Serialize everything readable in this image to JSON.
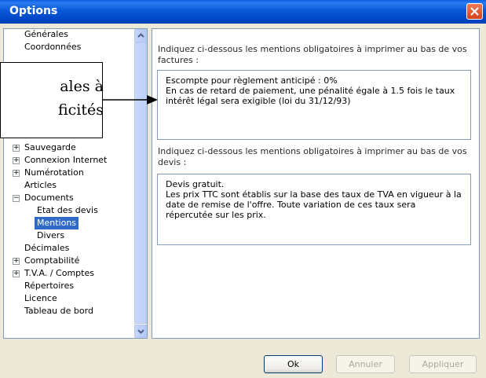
{
  "window": {
    "title": "Options",
    "close_icon": "close-icon"
  },
  "tree": {
    "items": [
      {
        "label": "Générales",
        "indent": 0,
        "expander": ""
      },
      {
        "label": "Coordonnées",
        "indent": 0,
        "expander": ""
      },
      {
        "label": "Sauvegarde",
        "indent": 0,
        "expander": "+"
      },
      {
        "label": "Connexion Internet",
        "indent": 0,
        "expander": "+"
      },
      {
        "label": "Numérotation",
        "indent": 0,
        "expander": "+"
      },
      {
        "label": "Articles",
        "indent": 0,
        "expander": ""
      },
      {
        "label": "Documents",
        "indent": 0,
        "expander": "−"
      },
      {
        "label": "Etat des devis",
        "indent": 1,
        "expander": ""
      },
      {
        "label": "Mentions",
        "indent": 1,
        "expander": "",
        "selected": true
      },
      {
        "label": "Divers",
        "indent": 1,
        "expander": ""
      },
      {
        "label": "Décimales",
        "indent": 0,
        "expander": ""
      },
      {
        "label": "Comptabilité",
        "indent": 0,
        "expander": "+"
      },
      {
        "label": "T.V.A. / Comptes",
        "indent": 0,
        "expander": "+"
      },
      {
        "label": "Répertoires",
        "indent": 0,
        "expander": ""
      },
      {
        "label": "Licence",
        "indent": 0,
        "expander": ""
      },
      {
        "label": "Tableau de bord",
        "indent": 0,
        "expander": ""
      }
    ],
    "selection_color": "#316ac5"
  },
  "factures": {
    "label": "Indiquez ci-dessous les mentions obligatoires à imprimer au bas de vos factures :",
    "value": "Escompte pour règlement anticipé : 0%\nEn cas de retard de paiement, une pénalité égale à 1.5 fois le taux intérêt légal sera exigible (loi du 31/12/93)"
  },
  "devis": {
    "label": "Indiquez ci-dessous les mentions obligatoires à imprimer au bas de vos devis :",
    "value": "Devis gratuit.\nLes prix TTC sont établis sur la base des taux de TVA en vigueur à la date de remise de l'offre. Toute variation de ces taux sera répercutée sur les prix."
  },
  "buttons": {
    "ok": "Ok",
    "cancel": "Annuler",
    "apply": "Appliquer"
  },
  "callout": {
    "line1": "ales à",
    "line2": "ficités"
  }
}
